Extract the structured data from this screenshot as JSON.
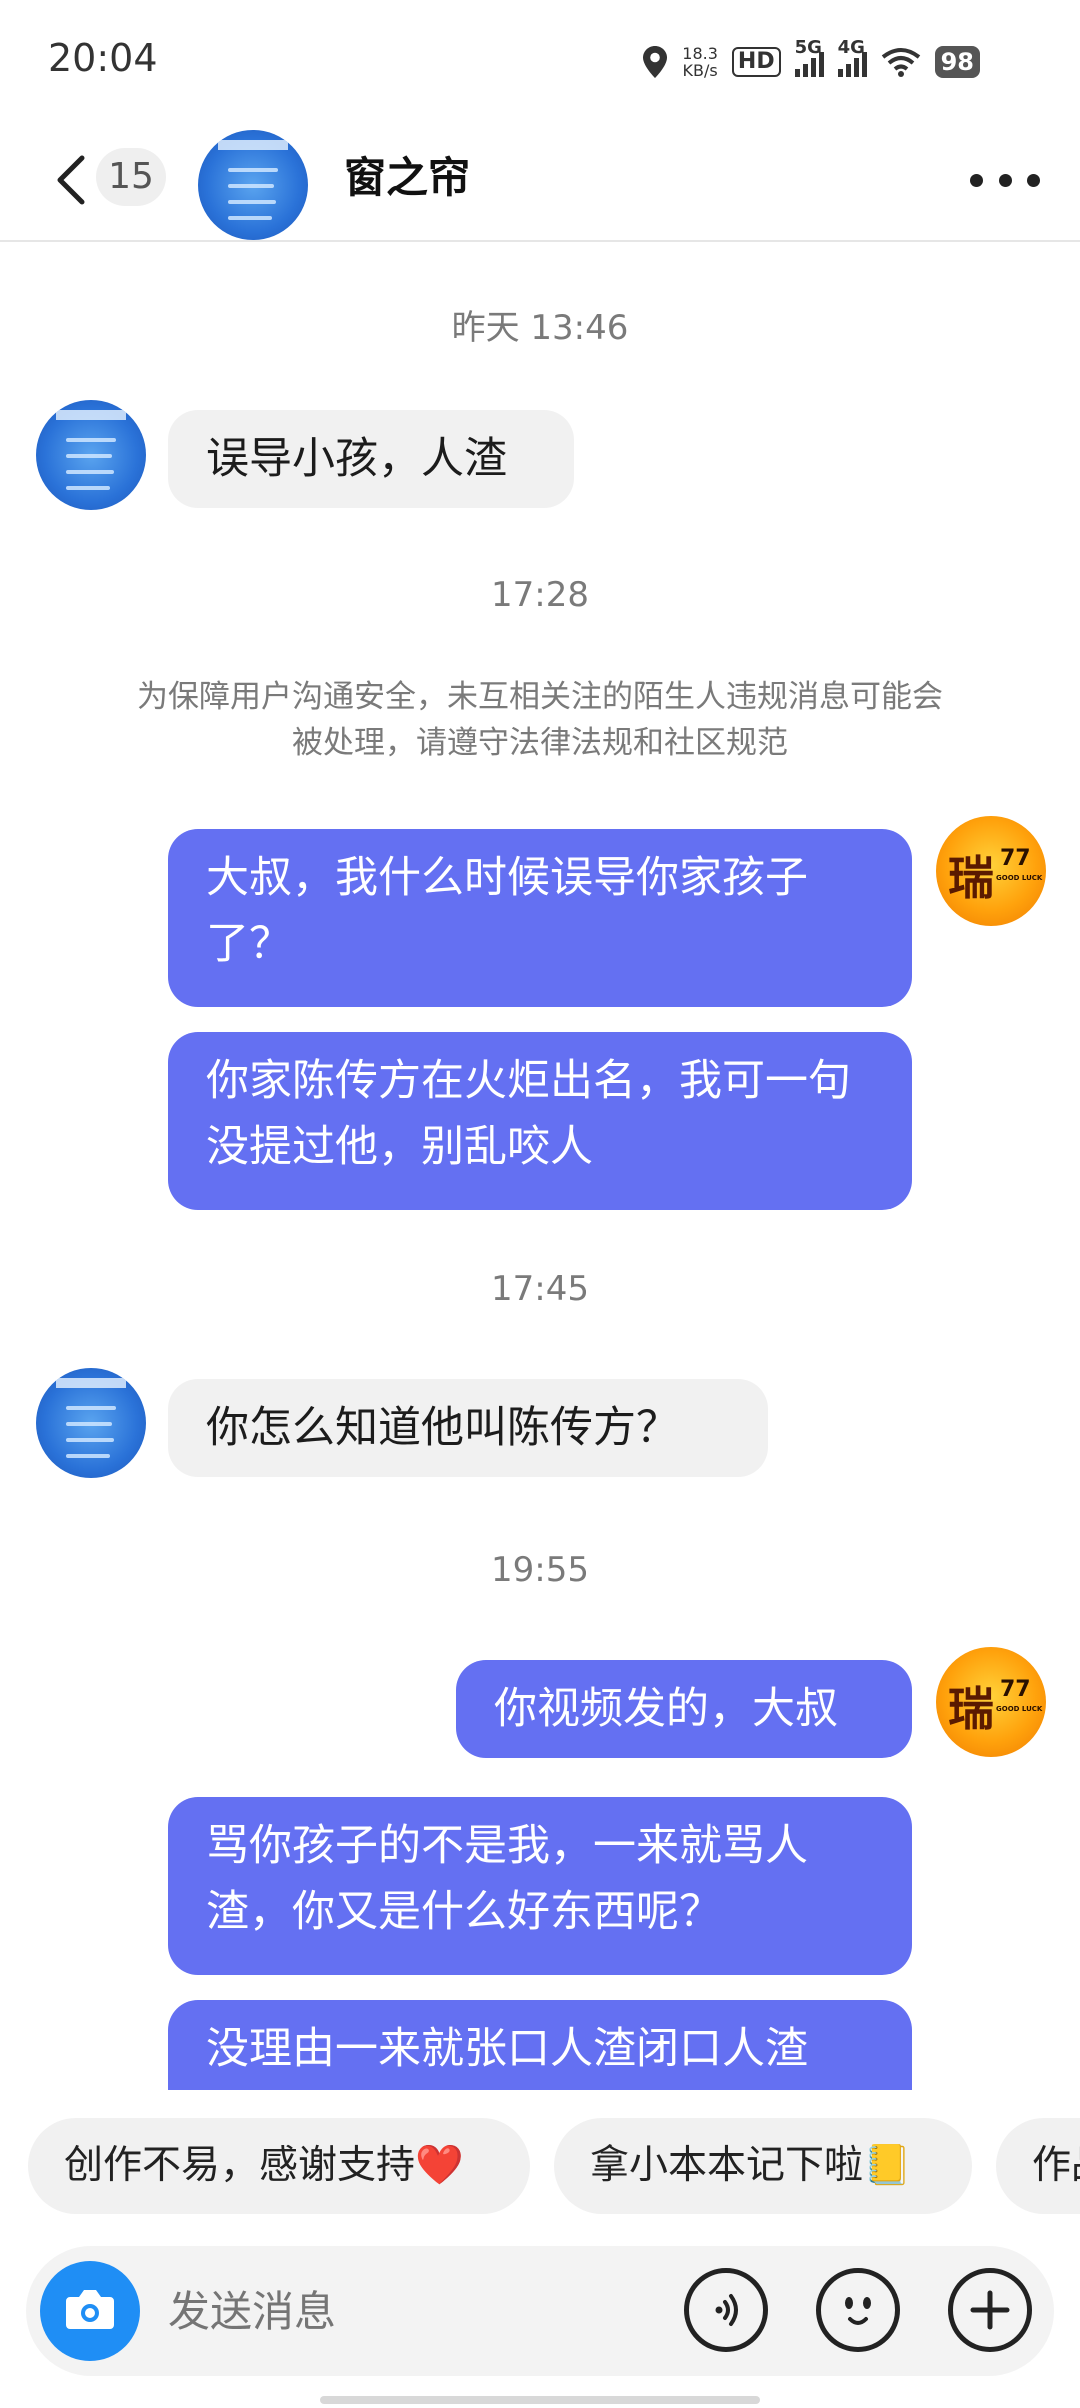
{
  "status_bar": {
    "time": "20:04",
    "net_speed_value": "18.3",
    "net_speed_unit": "KB/s",
    "hd_label": "HD",
    "signal1_label": "5G",
    "signal2_label": "4G",
    "battery": "98"
  },
  "header": {
    "badge_count": "15",
    "title": "窗之帘"
  },
  "chat": {
    "timestamps": [
      "昨天 13:46",
      "17:28",
      "17:45",
      "19:55"
    ],
    "notice": "为保障用户沟通安全，未互相关注的陌生人违规消息可能会被处理，请遵守法律法规和社区规范",
    "messages": [
      {
        "from": "other",
        "text": "误导小孩，人渣"
      },
      {
        "from": "me",
        "text": "大叔，我什么时候误导你家孩子了？"
      },
      {
        "from": "me",
        "text": "你家陈传方在火炬出名，我可一句没提过他，别乱咬人"
      },
      {
        "from": "other",
        "text": "你怎么知道他叫陈传方？"
      },
      {
        "from": "me",
        "text": "你视频发的，大叔"
      },
      {
        "from": "me",
        "text": "骂你孩子的不是我，一来就骂人渣，你又是什么好东西呢？"
      },
      {
        "from": "me",
        "text": "没理由一来就张口人渣闭口人渣"
      }
    ],
    "my_avatar_glyph": "瑞",
    "my_avatar_num": "77",
    "my_avatar_small": "GOOD LUCK"
  },
  "quick_replies": [
    "创作不易，感谢支持❤️",
    "拿小本本记下啦📒",
    "作品"
  ],
  "input": {
    "placeholder": "发送消息"
  },
  "colors": {
    "outgoing_bubble": "#6470f2",
    "incoming_bubble": "#f1f1f1",
    "camera_button": "#1f8ef5"
  }
}
